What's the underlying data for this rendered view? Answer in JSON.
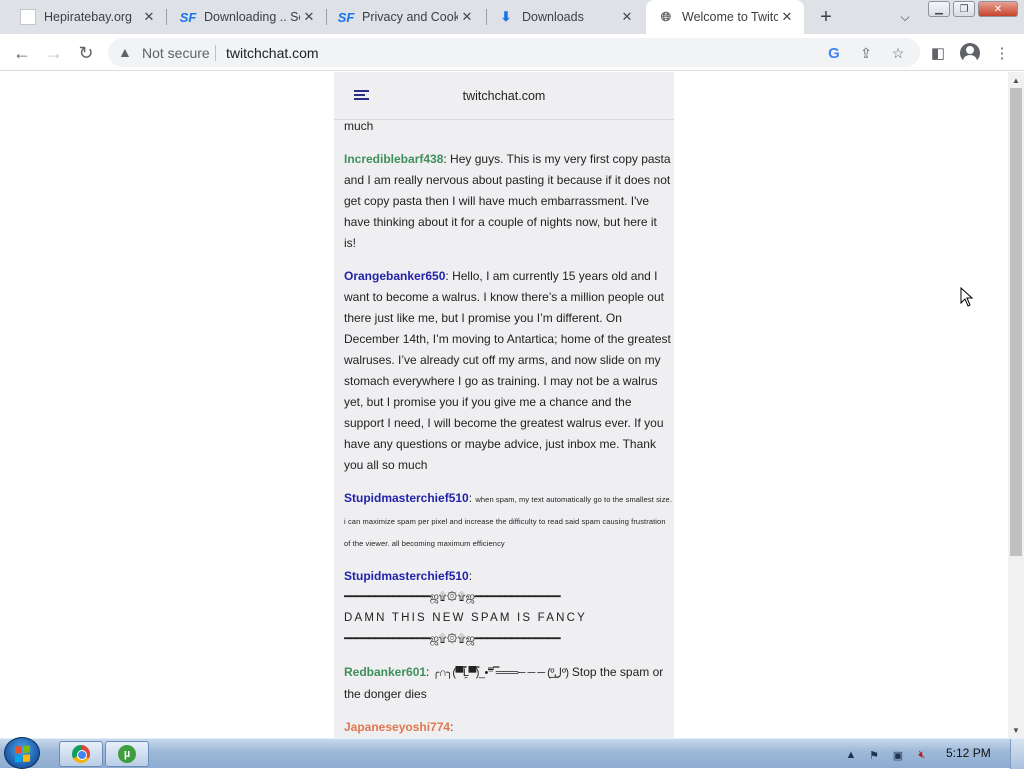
{
  "tabs": [
    {
      "title": "Hepiratebay.org",
      "favicon": "blank-page-icon"
    },
    {
      "title": "Downloading .. Sc",
      "favicon": "sourceforge-icon"
    },
    {
      "title": "Privacy and Cooki",
      "favicon": "sourceforge-icon"
    },
    {
      "title": "Downloads",
      "favicon": "download-icon"
    },
    {
      "title": "Welcome to Twitc",
      "favicon": "globe-icon",
      "active": true
    }
  ],
  "toolbar": {
    "security_label": "Not secure",
    "url": "twitchchat.com"
  },
  "page": {
    "site_title": "twitchchat.com"
  },
  "messages": {
    "m0": {
      "text": "much"
    },
    "m1": {
      "user": "Incrediblebarf438",
      "text": "Hey guys. This is my very first copy pasta and I am really nervous about pasting it because if it does not get copy pasta then I will have much embarrassment. I've have thinking about it for a couple of nights now, but here it is!"
    },
    "m2": {
      "user": "Orangebanker650",
      "text": "Hello, I am currently 15 years old and I want to become a walrus. I know there’s a million people out there just like me, but I promise you I’m different. On December 14th, I’m moving to Antartica; home of the greatest walruses. I’ve already cut off my arms, and now slide on my stomach everywhere I go as training. I may not be a walrus yet, but I promise you if you give me a chance and the support I need, I will become the greatest walrus ever. If you have any questions or maybe advice, just inbox me. Thank you all so much"
    },
    "m3": {
      "user": "Stupidmasterchief510",
      "text": "when spam, my text automatically go to the smallest size. i can maximize spam per pixel and increase the difficulty to read said spam causing frustration of the viewer. all becoming maximum efficiency"
    },
    "m4": {
      "user": "Stupidmasterchief510",
      "line1": "━━━━━━━━━━━━━━ஜ۩۞۩ஜ━━━━━━━━━━━━━━",
      "text": "DAMN THIS NEW SPAM IS FANCY",
      "line2": "━━━━━━━━━━━━━━ஜ۩۞۩ஜ━━━━━━━━━━━━━━"
    },
    "m5": {
      "user": "Redbanker601",
      "donger": "╭∩╮(▀̿Ĺ̯▀̿)_•⁼̿ ̿═══─ ─ ─ (ºل͟º)",
      "text": "Stop the spam or the donger dies"
    },
    "m6": {
      "user": "Japaneseyoshi774",
      "text": "▼◄▲►▼◄▲►▼◄▲►▼◄ ▲►▼◄▲▼◄▲►▼◄▲►▼◄▼◄▲►▼◄▲"
    }
  },
  "taskbar": {
    "clock": "5:12 PM"
  },
  "colors": {
    "user_green": "#3f8f5c",
    "user_blue": "#2222aa",
    "user_orange": "#e0784e",
    "chat_bg": "#efeff1"
  }
}
